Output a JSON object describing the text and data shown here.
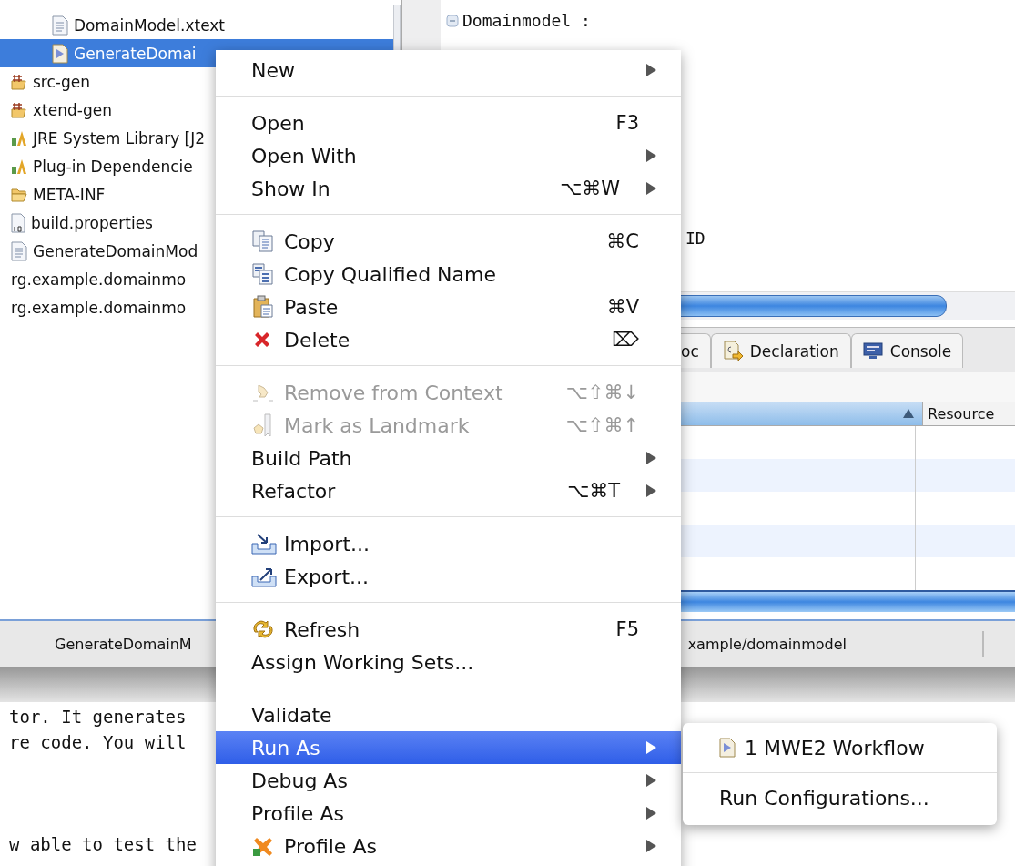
{
  "tree": {
    "items": [
      {
        "children": [
          {
            "label": "DomainModel.xtext",
            "selected": false
          },
          {
            "label": "GenerateDomai",
            "selected": true
          }
        ]
      },
      {
        "label": "src-gen",
        "selected": false
      },
      {
        "label": "xtend-gen",
        "selected": false
      },
      {
        "label": "JRE System Library [J2",
        "selected": false
      },
      {
        "label": "Plug-in Dependencie",
        "selected": false
      },
      {
        "label": "META-INF",
        "selected": false
      },
      {
        "label": "build.properties",
        "selected": false
      },
      {
        "label": "GenerateDomainMod",
        "selected": false
      },
      {
        "label": "rg.example.domainmo",
        "selected": false
      },
      {
        "label": "rg.example.domainmo",
        "selected": false
      }
    ]
  },
  "editor": {
    "first_line": "Domainmodel :",
    "fragment": "ID"
  },
  "tabs": [
    {
      "label": "oc"
    },
    {
      "label": "Declaration"
    },
    {
      "label": "Console"
    }
  ],
  "table": {
    "columns": [
      {
        "sorted": true
      },
      {
        "label": "Resource",
        "sorted": false
      }
    ]
  },
  "status_bar": {
    "left": "GenerateDomainM",
    "right": "xample/domainmodel"
  },
  "console": {
    "lines": [
      "tor. It generates",
      "re code. You will",
      "w able to test the"
    ]
  },
  "menu": {
    "items": [
      {
        "kind": "item",
        "label": "New",
        "submenu": true,
        "disabled": false,
        "selected": false
      },
      {
        "kind": "separator"
      },
      {
        "kind": "item",
        "label": "Open",
        "shortcut": "F3",
        "submenu": false,
        "disabled": false,
        "selected": false
      },
      {
        "kind": "item",
        "label": "Open With",
        "submenu": true,
        "disabled": false,
        "selected": false
      },
      {
        "kind": "item",
        "label": "Show In",
        "shortcut": "⌥⌘W",
        "submenu": true,
        "disabled": false,
        "selected": false
      },
      {
        "kind": "separator"
      },
      {
        "kind": "item",
        "label": "Copy",
        "shortcut": "⌘C",
        "submenu": false,
        "disabled": false,
        "selected": false
      },
      {
        "kind": "item",
        "label": "Copy Qualified Name",
        "submenu": false,
        "disabled": false,
        "selected": false
      },
      {
        "kind": "item",
        "label": "Paste",
        "shortcut": "⌘V",
        "submenu": false,
        "disabled": false,
        "selected": false
      },
      {
        "kind": "item",
        "label": "Delete",
        "shortcut": "⌦",
        "submenu": false,
        "disabled": false,
        "selected": false
      },
      {
        "kind": "separator"
      },
      {
        "kind": "item",
        "label": "Remove from Context",
        "shortcut": "⌥⇧⌘↓",
        "submenu": false,
        "disabled": true,
        "selected": false
      },
      {
        "kind": "item",
        "label": "Mark as Landmark",
        "shortcut": "⌥⇧⌘↑",
        "submenu": false,
        "disabled": true,
        "selected": false
      },
      {
        "kind": "item",
        "label": "Build Path",
        "submenu": true,
        "disabled": false,
        "selected": false
      },
      {
        "kind": "item",
        "label": "Refactor",
        "shortcut": "⌥⌘T",
        "submenu": true,
        "disabled": false,
        "selected": false
      },
      {
        "kind": "separator"
      },
      {
        "kind": "item",
        "label": "Import...",
        "submenu": false,
        "disabled": false,
        "selected": false
      },
      {
        "kind": "item",
        "label": "Export...",
        "submenu": false,
        "disabled": false,
        "selected": false
      },
      {
        "kind": "separator"
      },
      {
        "kind": "item",
        "label": "Refresh",
        "shortcut": "F5",
        "submenu": false,
        "disabled": false,
        "selected": false
      },
      {
        "kind": "item",
        "label": "Assign Working Sets...",
        "submenu": false,
        "disabled": false,
        "selected": false
      },
      {
        "kind": "separator"
      },
      {
        "kind": "item",
        "label": "Validate",
        "submenu": false,
        "disabled": false,
        "selected": false
      },
      {
        "kind": "item",
        "label": "Run As",
        "submenu": true,
        "disabled": false,
        "selected": true
      },
      {
        "kind": "item",
        "label": "Debug As",
        "submenu": true,
        "disabled": false,
        "selected": false
      },
      {
        "kind": "item",
        "label": "Profile As",
        "submenu": true,
        "disabled": false,
        "selected": false
      },
      {
        "kind": "item",
        "label": "Profile As",
        "submenu": true,
        "disabled": false,
        "selected": false
      }
    ]
  },
  "submenu": {
    "items": [
      {
        "kind": "item",
        "label": "1 MWE2 Workflow",
        "selected": false
      },
      {
        "kind": "separator"
      },
      {
        "kind": "item",
        "label": "Run Configurations...",
        "selected": false
      }
    ]
  }
}
